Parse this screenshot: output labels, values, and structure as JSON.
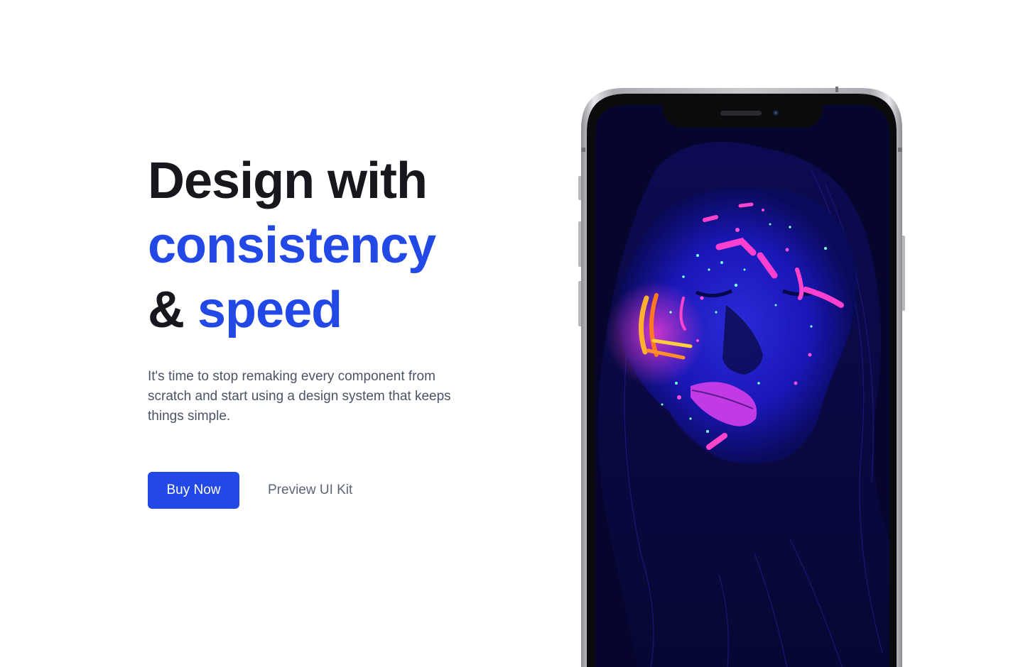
{
  "hero": {
    "headline": {
      "line1": "Design with",
      "line2": "consistency",
      "line3_prefix": "& ",
      "line3_accent": "speed"
    },
    "lead": "It's time to stop remaking every component from scratch and start using a design system that keeps things simple.",
    "primary_button": "Buy Now",
    "secondary_button": "Preview UI Kit"
  },
  "colors": {
    "accent": "#2249e6",
    "heading": "#16181d",
    "body_text": "#4b5366",
    "secondary_link": "#5d6578",
    "background": "#ffffff",
    "phone_screen": "#05052e"
  },
  "phone_mockup": {
    "device": "smartphone-frame-icon",
    "screen_image": "neon-uv-face-paint-portrait"
  }
}
